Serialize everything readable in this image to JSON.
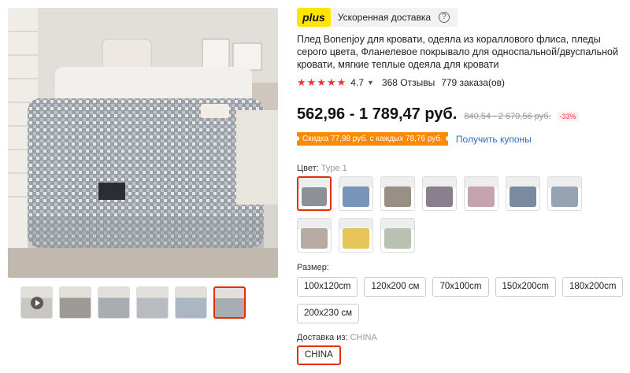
{
  "gallery": {
    "thumbnails": [
      {
        "name": "video",
        "has_play": true
      },
      {
        "name": "folded"
      },
      {
        "name": "texture"
      },
      {
        "name": "bed-gray"
      },
      {
        "name": "bed-blue"
      },
      {
        "name": "bed-main",
        "active": true
      }
    ]
  },
  "plus": {
    "badge": "plus",
    "text": "Ускоренная доставка",
    "help": "?"
  },
  "product": {
    "title": "Плед Bonenjoy для кровати, одеяла из кораллового флиса, пледы серого цвета, Фланелевое покрывало для односпальной/двуспальной кровати, мягкие теплые одеяла для кровати",
    "stars": "★★★★★",
    "rating": "4.7",
    "reviews": "368 Отзывы",
    "orders": "779 заказа(ов)"
  },
  "price": {
    "current": "562,96 - 1 789,47 руб.",
    "old": "840,54 - 2 670,56 руб.",
    "discount": "-33%"
  },
  "coupon": {
    "text": "Скидка 77,98 руб. с каждых 78,76 руб.",
    "link": "Получить купоны"
  },
  "color": {
    "label": "Цвет:",
    "selected": "Type 1",
    "swatches": [
      {
        "color": "#8d9196",
        "active": true
      },
      {
        "color": "#7894b8"
      },
      {
        "color": "#9a8f84"
      },
      {
        "color": "#8a7f8c"
      },
      {
        "color": "#c7a3ad"
      },
      {
        "color": "#7b8aa0"
      },
      {
        "color": "#95a3b3"
      },
      {
        "color": "#b7aaa3"
      },
      {
        "color": "#e6c45a"
      },
      {
        "color": "#b9c2b0"
      }
    ]
  },
  "size": {
    "label": "Размер:",
    "options": [
      "100x120cm",
      "120x200 см",
      "70x100cm",
      "150x200cm",
      "180x200cm",
      "200x230 см"
    ]
  },
  "shipping": {
    "label": "Доставка из:",
    "selected": "CHINA",
    "option": "CHINA"
  }
}
